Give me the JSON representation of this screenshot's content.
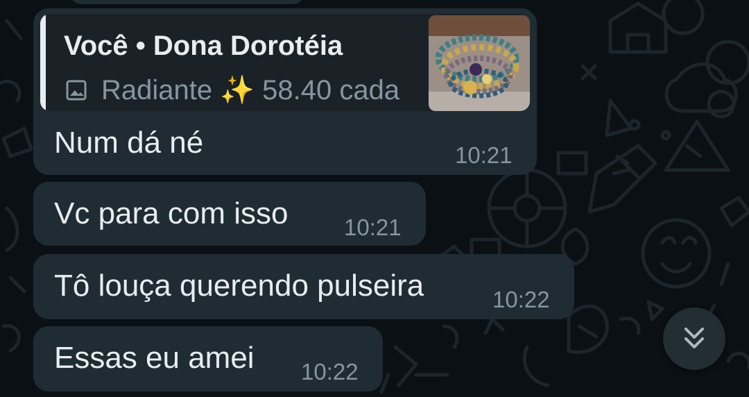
{
  "messages": [
    {
      "reply": {
        "author": "Você • Dona Dorotéia",
        "media_icon": "image-icon",
        "text": "Radiante ✨ 58.40 cada",
        "thumbnail": "bracelets-photo"
      },
      "text": "Num dá né",
      "time": "10:21"
    },
    {
      "text": "Vc para com isso",
      "time": "10:21"
    },
    {
      "text": "Tô louça querendo pulseira",
      "time": "10:22"
    },
    {
      "text": "Essas eu amei",
      "time": "10:22"
    }
  ],
  "scroll_button": {
    "icon": "double-chevron-down-icon"
  },
  "colors": {
    "background": "#0b1014",
    "bubble": "#1f2c33",
    "text": "#e9edef",
    "secondary_text": "#8696a0"
  }
}
